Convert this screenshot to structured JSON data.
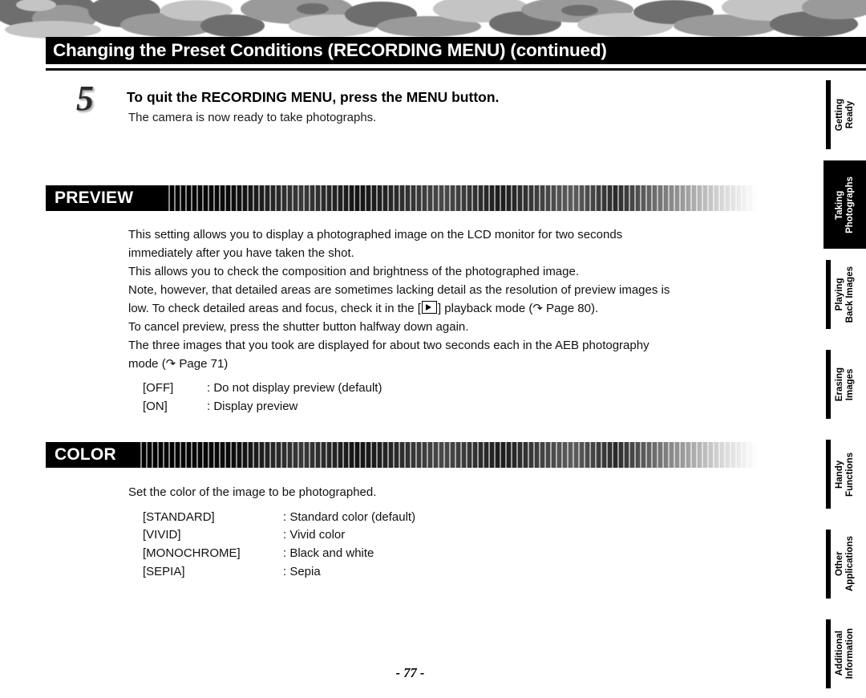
{
  "header": {
    "title": "Changing the Preset Conditions (RECORDING MENU) (continued)"
  },
  "step": {
    "number": "5",
    "title": "To quit the RECORDING MENU, press the MENU button.",
    "subtitle": "The camera is now ready to take photographs."
  },
  "sections": [
    {
      "id": "preview",
      "title": "PREVIEW",
      "paragraphs": [
        "This setting allows you to display a photographed image on the LCD monitor for two seconds",
        "immediately after you have taken the shot.",
        "This allows you to check the composition and brightness of the photographed image.",
        "Note, however, that detailed areas are sometimes lacking detail as the resolution of preview images is",
        "low. To check detailed areas and focus, check it in the [",
        "] playback mode (↷ Page 80).",
        "To cancel preview, press the shutter button halfway down again.",
        "The three images that you took are displayed for about two seconds each in the AEB photography",
        "mode (↷ Page 71)"
      ],
      "options": [
        {
          "key": "[OFF]",
          "value": ": Do not display preview (default)"
        },
        {
          "key": "[ON]",
          "value": ": Display preview"
        }
      ]
    },
    {
      "id": "color",
      "title": "COLOR",
      "paragraphs": [
        "Set the color of the image to be photographed."
      ],
      "options": [
        {
          "key": "[STANDARD]",
          "value": ": Standard color (default)"
        },
        {
          "key": "[VIVID]",
          "value": ": Vivid color"
        },
        {
          "key": "[MONOCHROME]",
          "value": ": Black and white"
        },
        {
          "key": "[SEPIA]",
          "value": ": Sepia"
        }
      ]
    }
  ],
  "side_tabs": [
    {
      "label": "Getting\nReady",
      "style": "light"
    },
    {
      "label": "Taking\nPhotographs",
      "style": "dark"
    },
    {
      "label": "Playing\nBack Images",
      "style": "light"
    },
    {
      "label": "Erasing\nImages",
      "style": "light"
    },
    {
      "label": "Handy\nFunctions",
      "style": "light"
    },
    {
      "label": "Other\nApplications",
      "style": "light"
    },
    {
      "label": "Additional\nInformation",
      "style": "light"
    }
  ],
  "footer": {
    "page_number": "- 77 -"
  }
}
